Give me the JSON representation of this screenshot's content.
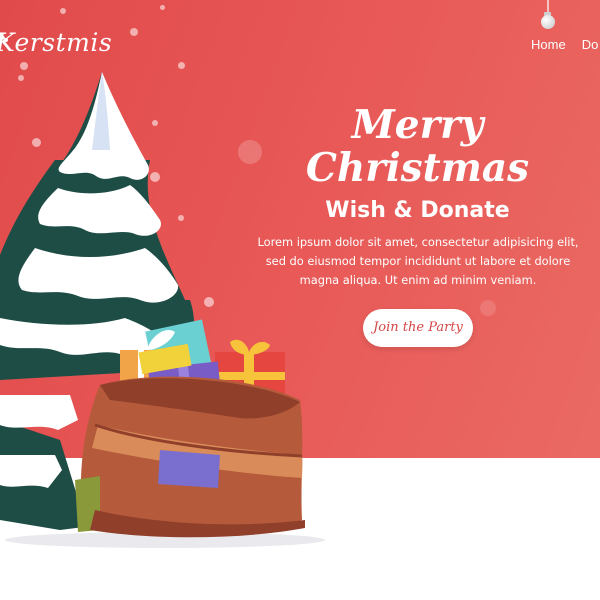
{
  "brand": {
    "logo_text": "Kerstmis",
    "logo_icon": "santa-hat-icon"
  },
  "nav": {
    "items": [
      "Home",
      "Do"
    ]
  },
  "hero": {
    "title": "Merry Christmas",
    "subtitle": "Wish & Donate",
    "body": "Lorem ipsum dolor sit amet, consectetur adipisicing elit, sed do eiusmod tempor incididunt ut labore et dolore magna aliqua. Ut enim ad minim veniam.",
    "cta_label": "Join the Party"
  },
  "decor": {
    "ornament_icon": "hanging-ornament-icon",
    "tree_icon": "snowy-christmas-tree-illustration",
    "sack_icon": "gift-sack-illustration"
  },
  "colors": {
    "hero_bg": "#e85a58",
    "button_text": "#d64646",
    "tree_dark": "#1e4d45",
    "snow": "#ffffff",
    "sack": "#b55a3b"
  }
}
